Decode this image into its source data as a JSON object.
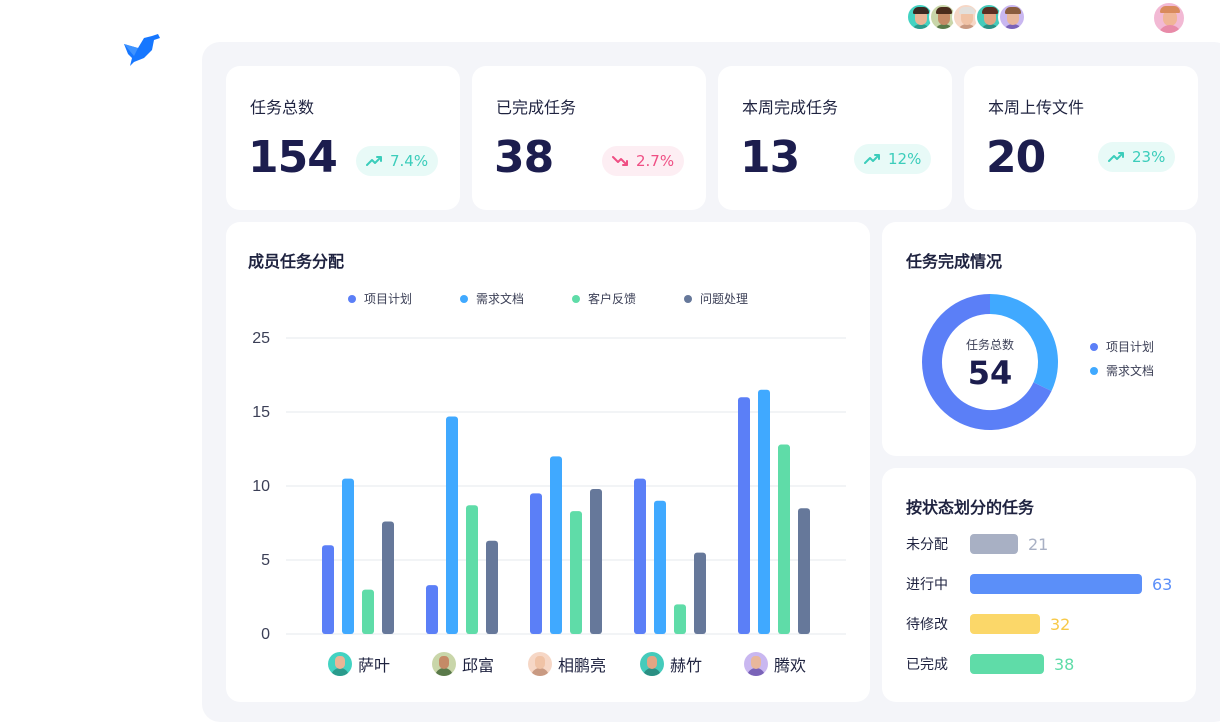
{
  "stats": [
    {
      "title": "任务总数",
      "value": "154",
      "change": "7.4%",
      "trend": "up"
    },
    {
      "title": "已完成任务",
      "value": "38",
      "change": "2.7%",
      "trend": "down"
    },
    {
      "title": "本周完成任务",
      "value": "13",
      "change": "12%",
      "trend": "up"
    },
    {
      "title": "本周上传文件",
      "value": "20",
      "change": "23%",
      "trend": "up"
    }
  ],
  "member_chart": {
    "title": "成员任务分配",
    "legend": [
      "项目计划",
      "需求文档",
      "客户反馈",
      "问题处理"
    ],
    "y_ticks": [
      "25",
      "15",
      "10",
      "5",
      "0"
    ],
    "members": [
      "萨叶",
      "邱富",
      "相鹏亮",
      "赫竹",
      "腾欢"
    ]
  },
  "donut": {
    "title": "任务完成情况",
    "center_label": "任务总数",
    "center_value": "54",
    "legend": [
      "项目计划",
      "需求文档"
    ]
  },
  "status": {
    "title": "按状态划分的任务",
    "rows": [
      {
        "label": "未分配",
        "value": "21"
      },
      {
        "label": "进行中",
        "value": "63"
      },
      {
        "label": "待修改",
        "value": "32"
      },
      {
        "label": "已完成",
        "value": "38"
      }
    ]
  },
  "colors": {
    "plan": "#5b7ff7",
    "docs": "#40a9ff",
    "feedback": "#5fdca8",
    "issues": "#66789a",
    "unassigned": "#a8b0c4",
    "in_progress": "#5b8ff9",
    "to_revise": "#fbd769",
    "done": "#5fdca8"
  },
  "chart_data": [
    {
      "type": "bar",
      "title": "成员任务分配",
      "categories": [
        "萨叶",
        "邱富",
        "相鹏亮",
        "赫竹",
        "腾欢"
      ],
      "y_ticks": [
        0,
        5,
        10,
        15,
        25
      ],
      "series": [
        {
          "name": "项目计划",
          "values": [
            6,
            3.3,
            9.5,
            10.5,
            17
          ]
        },
        {
          "name": "需求文档",
          "values": [
            10.5,
            14.7,
            12,
            9,
            18
          ]
        },
        {
          "name": "客户反馈",
          "values": [
            3,
            8.7,
            8.3,
            2,
            12.8
          ]
        },
        {
          "name": "问题处理",
          "values": [
            7.6,
            6.3,
            9.8,
            5.5,
            8.5
          ]
        }
      ],
      "grid": true,
      "legend_position": "top"
    },
    {
      "type": "pie",
      "title": "任务完成情况",
      "labels": [
        "项目计划",
        "需求文档"
      ],
      "values": [
        68,
        32
      ],
      "center_value": 54
    },
    {
      "type": "bar",
      "title": "按状态划分的任务",
      "categories": [
        "未分配",
        "进行中",
        "待修改",
        "已完成"
      ],
      "values": [
        21,
        63,
        32,
        38
      ],
      "orientation": "horizontal"
    }
  ]
}
